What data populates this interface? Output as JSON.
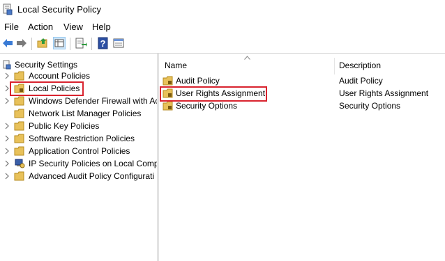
{
  "window": {
    "title": "Local Security Policy"
  },
  "menu": [
    "File",
    "Action",
    "View",
    "Help"
  ],
  "toolbar": {
    "buttons": [
      "back-arrow-icon",
      "forward-arrow-icon",
      "up-folder-icon",
      "show-hide-tree-icon",
      "export-list-icon",
      "help-icon",
      "properties-icon"
    ]
  },
  "tree": {
    "root": "Security Settings",
    "items": [
      {
        "label": "Account Policies"
      },
      {
        "label": "Local Policies"
      },
      {
        "label": "Windows Defender Firewall with Ac"
      },
      {
        "label": "Network List Manager Policies"
      },
      {
        "label": "Public Key Policies"
      },
      {
        "label": "Software Restriction Policies"
      },
      {
        "label": "Application Control Policies"
      },
      {
        "label": "IP Security Policies on Local Comp"
      },
      {
        "label": "Advanced Audit Policy Configurati"
      }
    ]
  },
  "list": {
    "columns": {
      "name": "Name",
      "description": "Description"
    },
    "rows": [
      {
        "name": "Audit Policy",
        "description": "Audit Policy"
      },
      {
        "name": "User Rights Assignment",
        "description": "User Rights Assignment"
      },
      {
        "name": "Security Options",
        "description": "Security Options"
      }
    ]
  },
  "colors": {
    "highlight_box": "#d9232e",
    "folder": "#e8c15a",
    "pressed": "#cce4f7"
  }
}
